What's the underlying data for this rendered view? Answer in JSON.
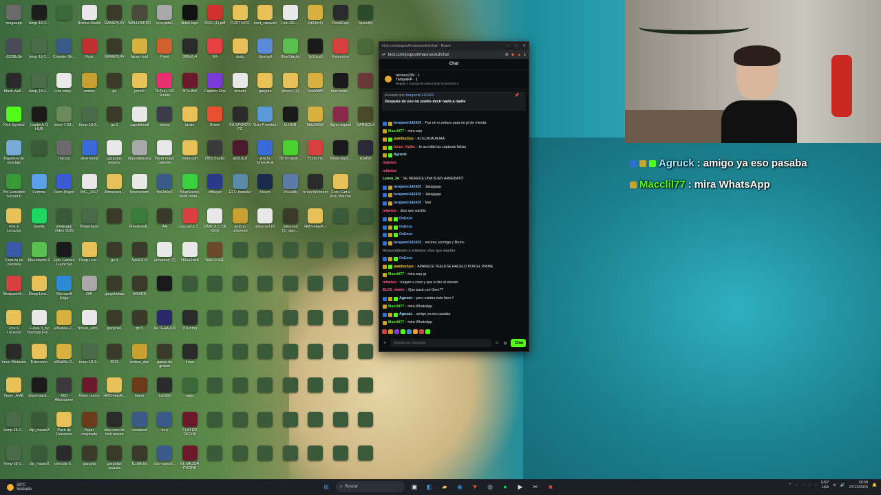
{
  "desktop": {
    "icons": [
      {
        "label": "megaupp",
        "c": "#6b6b6b"
      },
      {
        "label": "temp-18-2...",
        "c": "#1d1d1d"
      },
      {
        "label": "",
        "c": "#3a6a3a"
      },
      {
        "label": "Roblox Studio",
        "c": "#e8e8e8"
      },
      {
        "label": "GAMEPLAY",
        "c": "#3a3a2a"
      },
      {
        "label": "WALLPAPER",
        "c": "#4a4a3a"
      },
      {
        "label": "omegafe1",
        "c": "#a8a8a8"
      },
      {
        "label": "tiktok-logo",
        "c": "#111111"
      },
      {
        "label": "DOC-(1).pdf",
        "c": "#d0302e"
      },
      {
        "label": "FURTIVOS",
        "c": "#e8c058"
      },
      {
        "label": "mod_caravan",
        "c": "#e8c058"
      },
      {
        "label": "Link-DE-...",
        "c": "#e8e8e8"
      },
      {
        "label": "2d34fc41",
        "c": "#d8b040"
      },
      {
        "label": "DroidCam",
        "c": "#2b2b2b"
      },
      {
        "label": "Spicetify",
        "c": "#2b4b2b"
      },
      {
        "label": "d5238c9e",
        "c": "#4a4a5a"
      },
      {
        "label": "temp-18-2...",
        "c": "#4a6a4a"
      },
      {
        "label": "Counter-Str...",
        "c": "#3a5a8a"
      },
      {
        "label": "Rust",
        "c": "#c03030"
      },
      {
        "label": "GAMEPLAY",
        "c": "#3a3a2a"
      },
      {
        "label": "fanart-hud",
        "c": "#d8b040"
      },
      {
        "label": "Paint",
        "c": "#d06030"
      },
      {
        "label": "3ff6b2c4",
        "c": "#2a2a2a"
      },
      {
        "label": "EA",
        "c": "#e84040"
      },
      {
        "label": "dudo",
        "c": "#e8c058"
      },
      {
        "label": "Upscayl",
        "c": "#5a8ad8"
      },
      {
        "label": "BlueStacks",
        "c": "#5ac050"
      },
      {
        "label": "1e7dca3",
        "c": "#1a1a1a"
      },
      {
        "label": "Extension",
        "c": "#d84040"
      },
      {
        "label": "",
        "c": "#4a6a3a"
      },
      {
        "label": "black-wall...",
        "c": "#2a2a2a"
      },
      {
        "label": "temp-18-2...",
        "c": "#4a6a4a"
      },
      {
        "label": "cute-baby...",
        "c": "#e8e8e8"
      },
      {
        "label": "ambos",
        "c": "#c8a030"
      },
      {
        "label": "gs",
        "c": "#3a3a2a"
      },
      {
        "label": "jmod2",
        "c": "#e8c058"
      },
      {
        "label": "TikTok LIVE Studio",
        "c": "#e83070"
      },
      {
        "label": "3f7a-8b5",
        "c": "#6a1a2a"
      },
      {
        "label": "Capture One",
        "c": "#7a3ad8"
      },
      {
        "label": "stream",
        "c": "#e8e8e8"
      },
      {
        "label": "gargola",
        "c": "#e8c058"
      },
      {
        "label": "drivers (1)",
        "c": "#e8c058"
      },
      {
        "label": "5bb998f5",
        "c": "#d8b040"
      },
      {
        "label": "fam-textu...",
        "c": "#1a1a1a"
      },
      {
        "label": "",
        "c": "#6a3a3a"
      },
      {
        "label": "Kick-Symbol",
        "c": "#53fc18"
      },
      {
        "label": "Logitech G HUB",
        "c": "#1a1a1a"
      },
      {
        "label": "temp-7-23...",
        "c": "#6a8a5a"
      },
      {
        "label": "temp-18-2...",
        "c": "#4a6a4a"
      },
      {
        "label": "gs 2",
        "c": "#3a3a2a"
      },
      {
        "label": "capsilitmail",
        "c": "#e8e8e8"
      },
      {
        "label": "banco",
        "c": "#3a3a4a"
      },
      {
        "label": "lanim",
        "c": "#e8c058"
      },
      {
        "label": "Brave",
        "c": "#e85030"
      },
      {
        "label": "EA SPORTS FC",
        "c": "#2a2a2a"
      },
      {
        "label": "Vicio Premium",
        "c": "#5a9ad8"
      },
      {
        "label": "G HUB",
        "c": "#1a1a1a"
      },
      {
        "label": "5bb998b5",
        "c": "#d8b040"
      },
      {
        "label": "flayer miguel",
        "c": "#8a2a4a"
      },
      {
        "label": "GARGOLA",
        "c": "#4a4a2a"
      },
      {
        "label": "Papelera de reciclaje",
        "c": "#7aaad8"
      },
      {
        "label": "",
        "c": "#3a5a3a"
      },
      {
        "label": "micros",
        "c": "#6a6a6a"
      },
      {
        "label": "dineroteria",
        "c": "#3a6ad8"
      },
      {
        "label": "gargolas awards",
        "c": "#e8e8e8"
      },
      {
        "label": "depositphotos",
        "c": "#a8a8a8"
      },
      {
        "label": "flayer mayo caliente",
        "c": "#e8e8e8"
      },
      {
        "label": "minecraft",
        "c": "#e8c058"
      },
      {
        "label": "OBS Studio",
        "c": "#3a3a3a"
      },
      {
        "label": "a6113c9",
        "c": "#4a1a2a"
      },
      {
        "label": "ASUS DriverHub",
        "c": "#3a6ad8"
      },
      {
        "label": "56.97-desk...",
        "c": "#4ad030"
      },
      {
        "label": "7310c79c",
        "c": "#d84040"
      },
      {
        "label": "fondo-abst...",
        "c": "#1a1a1a"
      },
      {
        "label": "62ef58",
        "c": "#2a2a3a"
      },
      {
        "label": "Pro Evolution Soccer 6",
        "c": "#3a9a3a"
      },
      {
        "label": "Fortnite",
        "c": "#5aa0e8"
      },
      {
        "label": "Deco Player",
        "c": "#3a5ad8"
      },
      {
        "label": "IMG_2417",
        "c": "#e8e8e8"
      },
      {
        "label": "Almacena...",
        "c": "#e8c058"
      },
      {
        "label": "istockphoto",
        "c": "#e8e8e8"
      },
      {
        "label": "tcb2d2e5",
        "c": "#3a5a8a"
      },
      {
        "label": "BlueStacks Multi-Insta...",
        "c": "#3ad040"
      },
      {
        "label": "Afflayer",
        "c": "#2a3a8a"
      },
      {
        "label": "EFC-Installer",
        "c": "#5a8aa8"
      },
      {
        "label": "Steam",
        "c": "#1a2a4a"
      },
      {
        "label": "2f44a6b",
        "c": "#5a7aa8"
      },
      {
        "label": "Irriun Webcam",
        "c": "#2a2a2a"
      },
      {
        "label": "Can I Get a Kick Mauroo",
        "c": "#e8c058"
      },
      {
        "label": "",
        "c": "#3a5a3a"
      },
      {
        "label": "Pes 6 Locazos",
        "c": "#e8c058"
      },
      {
        "label": "Spotify",
        "c": "#1ed760"
      },
      {
        "label": "whatsapp Video 2025",
        "c": "#3a5a3a"
      },
      {
        "label": "Powerlevel",
        "c": "#4a6a4a"
      },
      {
        "label": "",
        "c": "#3a3a2a"
      },
      {
        "label": "FreeGoodl...",
        "c": "#3a7a3a"
      },
      {
        "label": "AA",
        "c": "#3a3a2a"
      },
      {
        "label": "upscayl-2.1...",
        "c": "#d84040"
      },
      {
        "label": "SIMBOLO DE KICK",
        "c": "#e8e8e8"
      },
      {
        "label": "ambos unturned",
        "c": "#c8a030"
      },
      {
        "label": "unturned (2)",
        "c": "#e8e8e8"
      },
      {
        "label": "unturned (1)_sign...",
        "c": "#3a3a2a"
      },
      {
        "label": "HMS-HaxA...",
        "c": "#e8c058"
      },
      {
        "label": "",
        "c": "#3a5a3a"
      },
      {
        "label": "",
        "c": "#3a5a3a"
      },
      {
        "label": "Captura de pantalla",
        "c": "#3a5aa8"
      },
      {
        "label": "BlueStacks X",
        "c": "#5ac050"
      },
      {
        "label": "Epic Games Launcher",
        "c": "#1a1a1a"
      },
      {
        "label": "Deep-Live...",
        "c": "#e8c058"
      },
      {
        "label": "gs 4",
        "c": "#3a3a2a"
      },
      {
        "label": "AWARDS",
        "c": "#3a3a2a"
      },
      {
        "label": "unnamed (2)",
        "c": "#e8e8e8"
      },
      {
        "label": "5f9ea2da8",
        "c": "#e8e8e8"
      },
      {
        "label": "WARZONE",
        "c": "#6a4a2a"
      },
      {
        "label": "",
        "c": "#3a5a3a"
      },
      {
        "label": "",
        "c": "#3a5a3a"
      },
      {
        "label": "",
        "c": "#3a5a3a"
      },
      {
        "label": "",
        "c": "#3a5a3a"
      },
      {
        "label": "",
        "c": "#3a5a3a"
      },
      {
        "label": "",
        "c": "#3a5a3a"
      },
      {
        "label": "ModpackM...",
        "c": "#d84040"
      },
      {
        "label": "Deep-Live...",
        "c": "#e8c058"
      },
      {
        "label": "Microsoft Edge",
        "c": "#2a8ad8"
      },
      {
        "label": "OIP",
        "c": "#a8a8a8"
      },
      {
        "label": "gargolinhas",
        "c": "#3a3a2a"
      },
      {
        "label": "AWARD",
        "c": "#3a3a2a"
      },
      {
        "label": "",
        "c": "#1a1a1a"
      },
      {
        "label": "",
        "c": "#3a5a3a"
      },
      {
        "label": "",
        "c": "#3a5a3a"
      },
      {
        "label": "",
        "c": "#3a5a3a"
      },
      {
        "label": "",
        "c": "#3a5a3a"
      },
      {
        "label": "",
        "c": "#3a5a3a"
      },
      {
        "label": "",
        "c": "#3a5a3a"
      },
      {
        "label": "",
        "c": "#3a5a3a"
      },
      {
        "label": "",
        "c": "#3a5a3a"
      },
      {
        "label": "Pes 6 Locazos",
        "c": "#e8c058"
      },
      {
        "label": "Futsal 3_by Bazinga Fre...",
        "c": "#e8e8e8"
      },
      {
        "label": "a96a56e-2...",
        "c": "#d8b040"
      },
      {
        "label": "fixture_elim...",
        "c": "#e8e8e8"
      },
      {
        "label": "gargola1",
        "c": "#3a3a2a"
      },
      {
        "label": "gs 5",
        "c": "#3a3a2a"
      },
      {
        "label": "Ae TERAJUS",
        "c": "#2a2a6a"
      },
      {
        "label": "ITKomm",
        "c": "#2a2a2a"
      },
      {
        "label": "",
        "c": "#3a5a3a"
      },
      {
        "label": "",
        "c": "#3a5a3a"
      },
      {
        "label": "",
        "c": "#3a5a3a"
      },
      {
        "label": "",
        "c": "#3a5a3a"
      },
      {
        "label": "",
        "c": "#3a5a3a"
      },
      {
        "label": "",
        "c": "#3a5a3a"
      },
      {
        "label": "",
        "c": "#3a5a3a"
      },
      {
        "label": "Irriun Webcam",
        "c": "#2a2a2a"
      },
      {
        "label": "Extension",
        "c": "#e8c058"
      },
      {
        "label": "a96a56e-2...",
        "c": "#d8b040"
      },
      {
        "label": "temp-18-2...",
        "c": "#4a6a4a"
      },
      {
        "label": "2021",
        "c": "#3a3a2a"
      },
      {
        "label": "ambos_dan",
        "c": "#c8a030"
      },
      {
        "label": "ganas de grabar",
        "c": "#3a3a2a"
      },
      {
        "label": "Irriun",
        "c": "#2a2a2a"
      },
      {
        "label": "",
        "c": "#3a5a3a"
      },
      {
        "label": "",
        "c": "#3a5a3a"
      },
      {
        "label": "",
        "c": "#3a5a3a"
      },
      {
        "label": "",
        "c": "#3a5a3a"
      },
      {
        "label": "",
        "c": "#3a5a3a"
      },
      {
        "label": "",
        "c": "#3a5a3a"
      },
      {
        "label": "",
        "c": "#3a5a3a"
      },
      {
        "label": "flayer_AME",
        "c": "#e8c058"
      },
      {
        "label": "black-back...",
        "c": "#1a1a1a"
      },
      {
        "label": "MSI Afterburner",
        "c": "#3a3a3a"
      },
      {
        "label": "flayer nuevo",
        "c": "#6a1a2a"
      },
      {
        "label": "HMS-HaxA...",
        "c": "#e8c058"
      },
      {
        "label": "flayer",
        "c": "#6a3a1a"
      },
      {
        "label": "1a5960",
        "c": "#2a2a2a"
      },
      {
        "label": "apps",
        "c": "#3a6a3a"
      },
      {
        "label": "",
        "c": "#3a5a3a"
      },
      {
        "label": "",
        "c": "#3a5a3a"
      },
      {
        "label": "",
        "c": "#3a5a3a"
      },
      {
        "label": "",
        "c": "#3a5a3a"
      },
      {
        "label": "",
        "c": "#3a5a3a"
      },
      {
        "label": "",
        "c": "#3a5a3a"
      },
      {
        "label": "",
        "c": "#3a5a3a"
      },
      {
        "label": "temp-18-1...",
        "c": "#4a6a4a"
      },
      {
        "label": "clip_mauro3",
        "c": "#3a5a3a"
      },
      {
        "label": "Pack de Recursos",
        "c": "#e8c058"
      },
      {
        "label": "flayer mejorado",
        "c": "#6a3a1a"
      },
      {
        "label": "idea cam de kick mauro",
        "c": "#2a2a2a"
      },
      {
        "label": "unnamed",
        "c": "#3a5a8a"
      },
      {
        "label": "toro",
        "c": "#3a5a8a"
      },
      {
        "label": "FLAYER TIKTOK",
        "c": "#6a1a2a"
      },
      {
        "label": "",
        "c": "#3a5a3a"
      },
      {
        "label": "",
        "c": "#3a5a3a"
      },
      {
        "label": "",
        "c": "#3a5a3a"
      },
      {
        "label": "",
        "c": "#3a5a3a"
      },
      {
        "label": "",
        "c": "#3a5a3a"
      },
      {
        "label": "",
        "c": "#3a5a3a"
      },
      {
        "label": "",
        "c": "#3a5a3a"
      },
      {
        "label": "temp-18-1...",
        "c": "#4a6a4a"
      },
      {
        "label": "clip_mauro2",
        "c": "#3a5a3a"
      },
      {
        "label": "pelicula-3...",
        "c": "#2a2a2a"
      },
      {
        "label": "gargola",
        "c": "#3a3a2a"
      },
      {
        "label": "gargolas awards",
        "c": "#3a3a2a"
      },
      {
        "label": "f1cb0c9a",
        "c": "#3a3a2a"
      },
      {
        "label": "toro-upscal...",
        "c": "#3a5a8a"
      },
      {
        "label": "EL MEJOR PHONK",
        "c": "#6a1a2a"
      },
      {
        "label": "",
        "c": "#3a5a3a"
      },
      {
        "label": "",
        "c": "#3a5a3a"
      },
      {
        "label": "",
        "c": "#3a5a3a"
      },
      {
        "label": "",
        "c": "#3a5a3a"
      },
      {
        "label": "",
        "c": "#3a5a3a"
      },
      {
        "label": "",
        "c": "#3a5a3a"
      },
      {
        "label": "",
        "c": "#3a5a3a"
      }
    ]
  },
  "browser": {
    "window_title": "kick.com/popout/mauroookd/chat - Brave",
    "url": "kick.com/popout/mauroookd/chat",
    "chat_title": "Chat",
    "gifter_name": "nicolas23N",
    "gifter_count": "1",
    "gifter2_name": "TampaRP",
    "gifter2_count": "1",
    "gifter_sub": "Regala 1 suscripción para tomar la posición 3",
    "pinned_by_label": "Enviado por",
    "pinned_by_user": "benjamin142420",
    "pinned_text": "Después de eso no podés decir nada a nadie",
    "input_placeholder": "Enviar un mensaje",
    "chat_button": "Chat"
  },
  "messages": [
    {
      "user": "benjamin142420",
      "text": "Fue un re pelazo para mi gil de mierda",
      "color": "#7cb8ff",
      "badges": [
        "#2e6fd8",
        "#c9a227"
      ]
    },
    {
      "user": "Macclil77",
      "text": "mira wsp",
      "color": "#53fc18",
      "badges": [
        "#c9a227"
      ]
    },
    {
      "user": "pablitoclips",
      "text": "AJSJJAJAJAJAA",
      "color": "#ffd23f",
      "badges": [
        "#c9a227",
        "#53fc18"
      ]
    },
    {
      "user": "lucas_elpibe",
      "text": "te acordás las capturas falsas",
      "color": "#ff5a5a",
      "badges": [
        "#c9a227",
        "#53fc18"
      ]
    },
    {
      "user": "Agrucic",
      "text": "",
      "color": "#a0e8ff",
      "badges": [
        "#c9a227",
        "#53fc18"
      ]
    },
    {
      "user": "milwisis",
      "text": "",
      "color": "#ff5a8a",
      "badges": []
    },
    {
      "user": "milwisis",
      "text": "",
      "color": "#ff5a8a",
      "badges": []
    },
    {
      "user": "Leoen_24",
      "text": "SE MERECE UNA BUEN ARREBATÓ",
      "color": "#b0ff9a",
      "badges": []
    },
    {
      "user": "benjamin142420",
      "text": "Jakajajaja",
      "color": "#7cb8ff",
      "badges": [
        "#2e6fd8",
        "#c9a227"
      ]
    },
    {
      "user": "benjamin142420",
      "text": "Jakajajaja",
      "color": "#7cb8ff",
      "badges": [
        "#2e6fd8",
        "#c9a227"
      ]
    },
    {
      "user": "benjamin142420",
      "text": "Mal",
      "color": "#7cb8ff",
      "badges": [
        "#2e6fd8",
        "#c9a227"
      ]
    },
    {
      "user": "milwisis",
      "text": "dios que wachin",
      "color": "#ff5a8a",
      "badges": []
    },
    {
      "user": "OxEnzo",
      "text": "",
      "color": "#7cb8ff",
      "badges": [
        "#2e6fd8",
        "#c9a227",
        "#53fc18"
      ]
    },
    {
      "user": "OxEnzo",
      "text": "",
      "color": "#7cb8ff",
      "badges": [
        "#2e6fd8",
        "#c9a227",
        "#53fc18"
      ]
    },
    {
      "user": "OxEnzo",
      "text": "",
      "color": "#7cb8ff",
      "badges": [
        "#2e6fd8",
        "#c9a227",
        "#53fc18"
      ]
    },
    {
      "user": "benjamin142420",
      "text": "encima conmigo y Bruno",
      "color": "#7cb8ff",
      "badges": [
        "#2e6fd8",
        "#c9a227"
      ]
    },
    {
      "user": "Respondiendo a milwisis: dios que wachin",
      "text": "",
      "color": "#888888",
      "badges": []
    },
    {
      "user": "OxEnzo",
      "text": "",
      "color": "#7cb8ff",
      "badges": [
        "#2e6fd8",
        "#c9a227",
        "#53fc18"
      ]
    },
    {
      "user": "pablitoclips",
      "text": "APARECE TEELESE HACELO POR EL PRIME",
      "color": "#ffd23f",
      "badges": [
        "#c9a227",
        "#53fc18"
      ]
    },
    {
      "user": "Macclil77",
      "text": "mira wsp gt",
      "color": "#53fc18",
      "badges": [
        "#c9a227"
      ]
    },
    {
      "user": "milwisis",
      "text": "traigan a coso y que le tire al stream",
      "color": "#ff5a8a",
      "badges": []
    },
    {
      "user": "ELXS_ehdeh",
      "text": "Que pasó con Gero??",
      "color": "#ff5a8a",
      "badges": []
    },
    {
      "user": "Agrucic",
      "text": "pero estaba todo bien !!",
      "color": "#a0e8ff",
      "badges": [
        "#2e6fd8",
        "#c9a227",
        "#53fc18"
      ]
    },
    {
      "user": "Macclil77",
      "text": "mira WhatsApp",
      "color": "#53fc18",
      "badges": [
        "#c9a227"
      ]
    },
    {
      "user": "Agrucic",
      "text": "amigo ya eso pasaba",
      "color": "#a0e8ff",
      "badges": [
        "#2e6fd8",
        "#c9a227",
        "#53fc18"
      ]
    },
    {
      "user": "Macclil77",
      "text": "mira WhatsApp",
      "color": "#53fc18",
      "badges": [
        "#c9a227"
      ]
    }
  ],
  "stream_overlay": {
    "line1_user": "Agruck",
    "line1_text": "amigo ya eso pasaba",
    "line2_user": "Macclil77",
    "line2_text": "mira WhatsApp"
  },
  "taskbar": {
    "temp": "33°C",
    "weather": "Soleado",
    "search_label": "Buscar",
    "lang1": "ESP",
    "lang2": "LAA",
    "time": "18:39",
    "date": "27/12/2025"
  }
}
